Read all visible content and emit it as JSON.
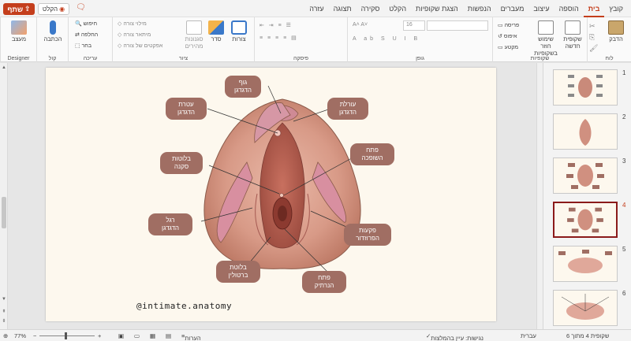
{
  "tabbar": {
    "share": "שתף",
    "record": "הקלט",
    "tabs": [
      "קובץ",
      "בית",
      "הוספה",
      "עיצוב",
      "מעברים",
      "הנפשות",
      "הצגת שקופיות",
      "הקלט",
      "סקירה",
      "תצוגה",
      "עזרה"
    ],
    "active_tab": "בית"
  },
  "ribbon": {
    "clipboard": {
      "label": "לוח",
      "paste": "הדבק"
    },
    "slides": {
      "label": "שקופיות",
      "new_slide": "שקופית חדשה",
      "reuse": "שימוש חוזר בשקופיות",
      "layout": "פריסה",
      "reset": "איפוס",
      "section": "מקטע"
    },
    "font": {
      "label": "גופן",
      "size": "16"
    },
    "paragraph": {
      "label": "פיסקה"
    },
    "drawing": {
      "label": "ציור",
      "shapes": "צורות",
      "arrange": "סדר",
      "styles": "סגנונות מהירים",
      "fill": "מילוי צורה",
      "outline": "מיתאר צורה",
      "effects": "אפקטים של צורה"
    },
    "editing": {
      "label": "עריכה",
      "find": "חיפוש",
      "replace": "החלפה",
      "select": "בחר"
    },
    "voice": {
      "label": "קול",
      "dictate": "הכתבה"
    },
    "designer": {
      "label": "Designer",
      "designer_btn": "מעצב"
    }
  },
  "slide": {
    "labels": {
      "glans": "גוף\nהדגדגן",
      "crura_top": "עטרת\nהדגדגן",
      "foreskin": "עורלת\nהדגדגן",
      "skene": "בלוטות\nסקנה",
      "urethra": "פתח\nהשופכה",
      "leg": "רגל\nהדגדגן",
      "vestibular": "פקעות\nהפרוזדור",
      "bartholin": "בלוטת\nברטולין",
      "vagina": "פתח\nהנרתיק"
    },
    "watermark": "@intimate.anatomy"
  },
  "thumbnails": {
    "numbers": [
      "1",
      "2",
      "3",
      "4",
      "5",
      "6"
    ],
    "selected": "4"
  },
  "status": {
    "zoom": "77%",
    "notes": "הערות",
    "accessibility": "נגישות: עיין בהמלצות",
    "language": "עברית",
    "slide_count": "שקופית 4 מתוך 6"
  },
  "colors": {
    "accent": "#c43e1c",
    "label_bg": "#a06e63",
    "slide_bg": "#fdf8ee"
  }
}
